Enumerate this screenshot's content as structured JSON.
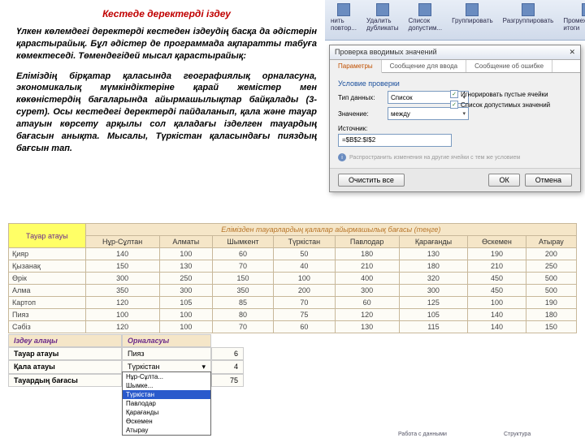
{
  "title": "Кестеде деректерді іздеу",
  "para1": "Үлкен көлемдегі деректерді кестеден іздеудің басқа да әдістерін қарастырайық. Бұл әдістер де программада ақпаратты табуға көмектеседі. Төмендегідей мысал қарастырайық:",
  "para2": "Еліміздің бірқатар қаласында географиялық орналасуна, экономикалық мүмкіндіктеріне қарай жемістер мен көкөністердің бағаларында айырмашылықтар байқалады (3-сурет). Осы кестедегі деректерді пайдаланып, қала және тауар атауын көрсету арқылы сол қаладағы ізделген тауардың бағасын анықта. Мысалы, Түркістан қаласындағы пияздың бағсын тап.",
  "ribbon": {
    "r1": "нить повтор...",
    "r2": "Удалить дубликаты",
    "r3": "Список допустим...",
    "r4": "Группировать",
    "r5": "Разгруппировать",
    "r6": "Промежуточные итоги",
    "g1": "Работа с данными",
    "g2": "Структура"
  },
  "dialog": {
    "title": "Проверка вводимых значений",
    "tabs": [
      "Параметры",
      "Сообщение для ввода",
      "Сообщение об ошибке"
    ],
    "section": "Условие проверки",
    "type_label": "Тип данных:",
    "type_value": "Список",
    "val_label": "Значение:",
    "val_value": "между",
    "chk1": "Игнорировать пустые ячейки",
    "chk2": "Список допустимых значений",
    "src_label": "Источник:",
    "src_value": "=$B$2:$I$2",
    "note": "Распространить изменения на другие ячейки с тем же условием",
    "btn_clear": "Очистить все",
    "btn_ok": "ОК",
    "btn_cancel": "Отмена"
  },
  "table": {
    "name_header": "Тауар атауы",
    "group_header": "Елімізден тауарлардың қалалар айырмашылық бағасы (теңге)",
    "cities": [
      "Нұр-Сұлтан",
      "Алматы",
      "Шымкент",
      "Түркістан",
      "Павлодар",
      "Қарағанды",
      "Өскемен",
      "Атырау"
    ],
    "rows": [
      {
        "n": "Қияр",
        "v": [
          140,
          100,
          60,
          50,
          180,
          130,
          190,
          200
        ]
      },
      {
        "n": "Қызанақ",
        "v": [
          150,
          130,
          70,
          40,
          210,
          180,
          210,
          250
        ]
      },
      {
        "n": "Өрік",
        "v": [
          300,
          250,
          150,
          100,
          400,
          320,
          450,
          500
        ]
      },
      {
        "n": "Алма",
        "v": [
          350,
          300,
          350,
          200,
          300,
          300,
          450,
          500
        ]
      },
      {
        "n": "Картоп",
        "v": [
          120,
          105,
          85,
          70,
          60,
          125,
          100,
          190
        ]
      },
      {
        "n": "Пияз",
        "v": [
          100,
          100,
          80,
          75,
          120,
          105,
          140,
          180
        ]
      },
      {
        "n": "Сәбіз",
        "v": [
          120,
          100,
          70,
          60,
          130,
          115,
          140,
          150
        ]
      }
    ]
  },
  "search": {
    "h1": "Іздеу алаңы",
    "h2": "Орналасуы",
    "r1_label": "Тауар атауы",
    "r1_val": "Пияз",
    "r1_num": "6",
    "r2_label": "Қала атауы",
    "r2_val": "Түркістан",
    "r2_num": "4",
    "r3_label": "Тауардың бағасы",
    "r3_val": "",
    "r3_num": "75",
    "dropdown": [
      "Нұр-Сұлта...",
      "Шымке...",
      "Түркістан",
      "Павлодар",
      "Қарағанды",
      "Өскемен",
      "Атырау"
    ]
  }
}
